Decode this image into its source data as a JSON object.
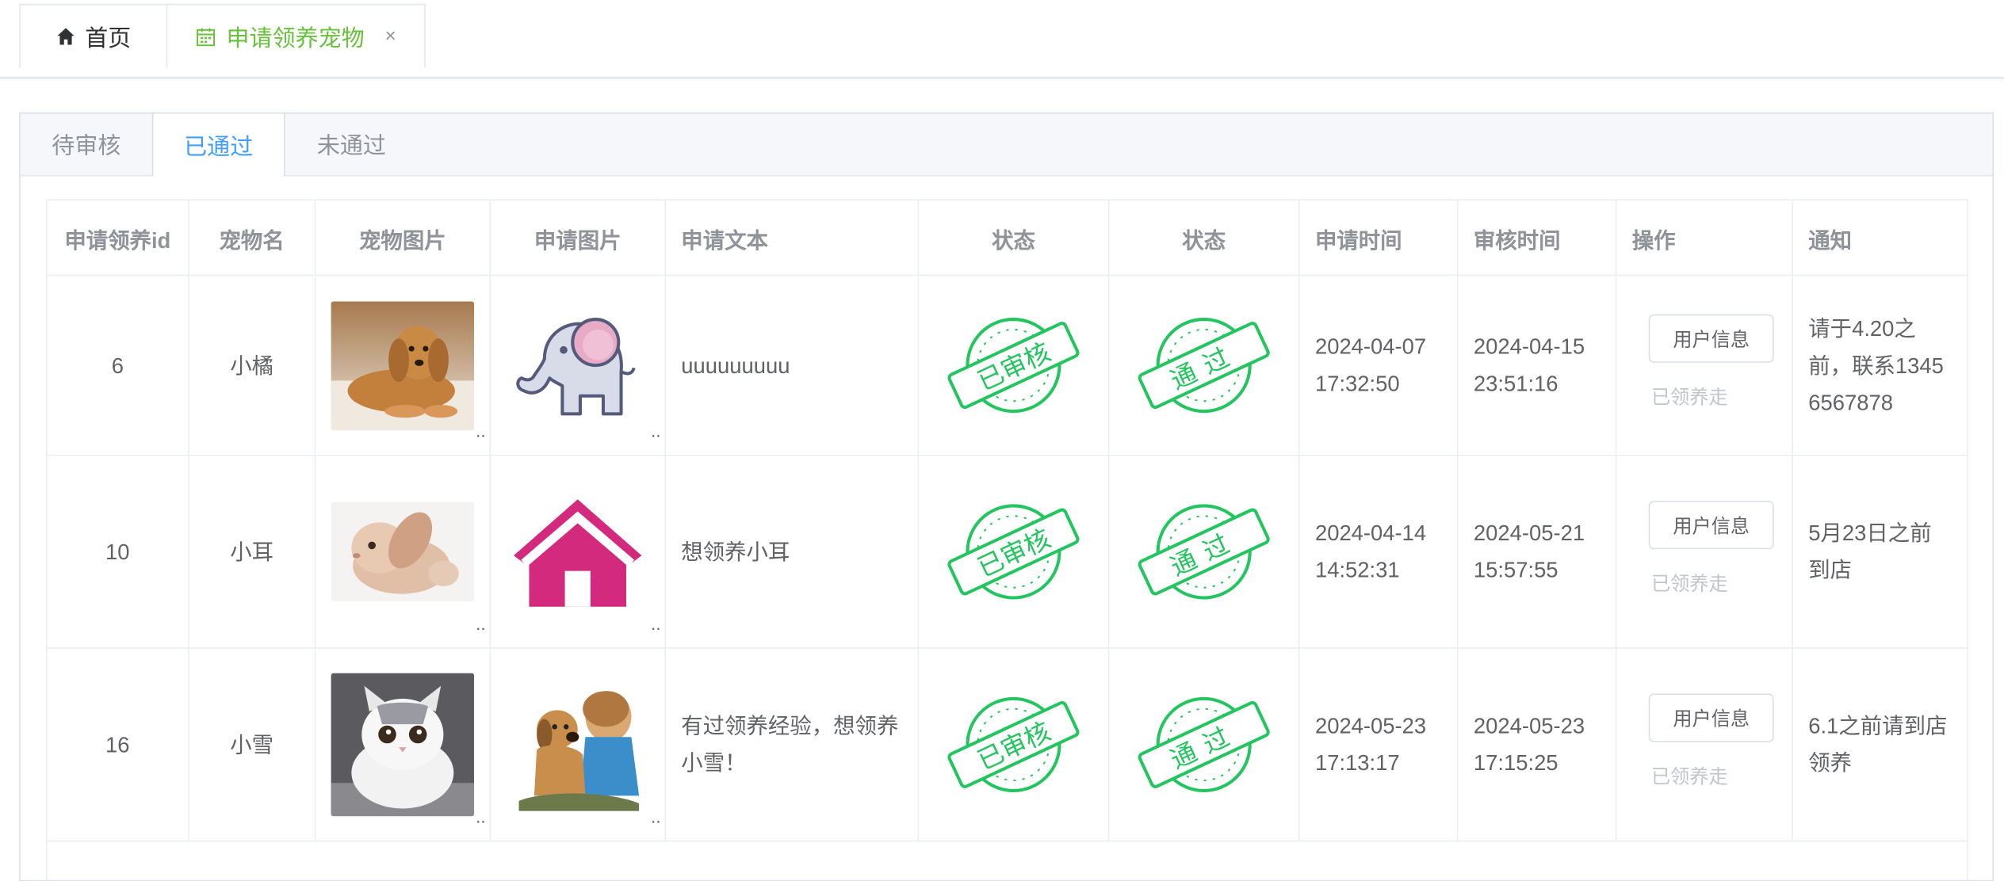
{
  "page_tabs": [
    {
      "label": "首页",
      "icon": "home-icon"
    },
    {
      "label": "申请领养宠物",
      "icon": "calendar-icon",
      "close": "×"
    }
  ],
  "tabs": [
    "待审核",
    "已通过",
    "未通过"
  ],
  "active_tab": "已通过",
  "columns": [
    "申请领养id",
    "宠物名",
    "宠物图片",
    "申请图片",
    "申请文本",
    "状态",
    "状态",
    "申请时间",
    "审核时间",
    "操作",
    "通知"
  ],
  "rows": [
    {
      "id": "6",
      "pet_name": "小橘",
      "pet_image": "puppy-photo",
      "apply_image": "elephant-icon",
      "text": "uuuuuuuuu",
      "status1": "已审核",
      "status2": "通过",
      "apply_time_date": "2024-04-07",
      "apply_time_time": "17:32:50",
      "review_time_date": "2024-04-15",
      "review_time_time": "23:51:16",
      "action": "用户信息",
      "action_note": "已领养走",
      "notice": "请于4.20之前，联系13456567878"
    },
    {
      "id": "10",
      "pet_name": "小耳",
      "pet_image": "rabbit-photo",
      "apply_image": "house-icon",
      "text": "想领养小耳",
      "status1": "已审核",
      "status2": "通过",
      "apply_time_date": "2024-04-14",
      "apply_time_time": "14:52:31",
      "review_time_date": "2024-05-21",
      "review_time_time": "15:57:55",
      "action": "用户信息",
      "action_note": "已领养走",
      "notice": "5月23日之前到店"
    },
    {
      "id": "16",
      "pet_name": "小雪",
      "pet_image": "cat-photo",
      "apply_image": "kid-with-dog-photo",
      "text": "有过领养经验，想领养小雪！",
      "status1": "已审核",
      "status2": "通过",
      "apply_time_date": "2024-05-23",
      "apply_time_time": "17:13:17",
      "review_time_date": "2024-05-23",
      "review_time_time": "17:15:25",
      "action": "用户信息",
      "action_note": "已领养走",
      "notice": "6.1之前请到店领养"
    }
  ],
  "colors": {
    "accent": "#409eff",
    "tab_active": "#67c23a",
    "stamp": "#22c55e"
  }
}
